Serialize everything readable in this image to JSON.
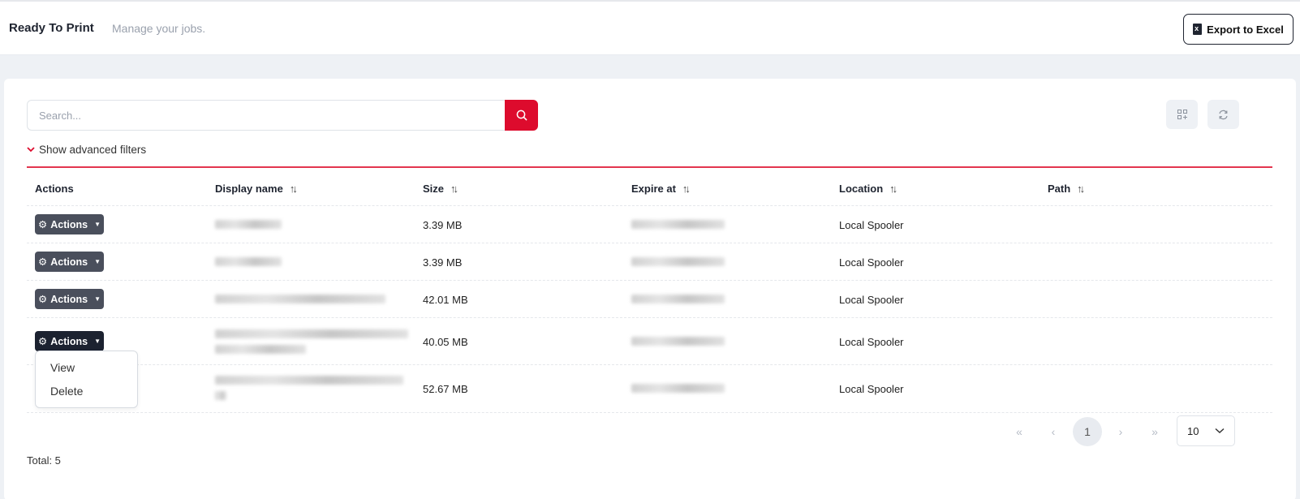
{
  "header": {
    "title": "Ready To Print",
    "subtitle": "Manage your jobs.",
    "export_label": "Export to Excel"
  },
  "search": {
    "placeholder": "Search..."
  },
  "filters": {
    "toggle_label": "Show advanced filters"
  },
  "table": {
    "columns": [
      "Actions",
      "Display name",
      "Size",
      "Expire at",
      "Location",
      "Path"
    ],
    "action_label": "Actions",
    "rows": [
      {
        "size": "3.39 MB",
        "location": "Local Spooler"
      },
      {
        "size": "3.39 MB",
        "location": "Local Spooler"
      },
      {
        "size": "42.01 MB",
        "location": "Local Spooler"
      },
      {
        "size": "40.05 MB",
        "location": "Local Spooler"
      },
      {
        "size": "52.67 MB",
        "location": "Local Spooler"
      }
    ]
  },
  "dropdown": {
    "items": [
      "View",
      "Delete"
    ]
  },
  "footer": {
    "total": "Total: 5"
  },
  "pagination": {
    "first": "«",
    "prev": "‹",
    "current": "1",
    "next": "›",
    "last": "»",
    "page_size": "10"
  },
  "colors": {
    "accent": "#dd0b2d",
    "action_button": "#4a4f5c"
  }
}
